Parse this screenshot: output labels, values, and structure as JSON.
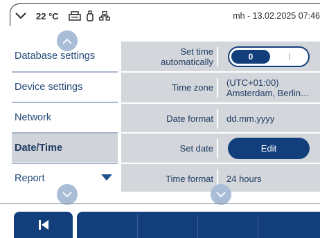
{
  "status_bar": {
    "temperature": "22 °C",
    "device_info": "mh - 13.02.2025 07:46",
    "icons": [
      "chevron-down-icon",
      "printer-icon",
      "usb-drive-icon",
      "network-icon"
    ]
  },
  "menu": {
    "items": [
      {
        "label": "Database settings"
      },
      {
        "label": "Device settings"
      },
      {
        "label": "Network"
      },
      {
        "label": "Date/Time",
        "active": true
      },
      {
        "label": "Report"
      }
    ]
  },
  "settings": {
    "set_time_auto": {
      "label_line1": "Set time",
      "label_line2": "automatically",
      "toggle_value": "0"
    },
    "time_zone": {
      "label": "Time zone",
      "value_line1": "(UTC+01:00)",
      "value_line2": "Amsterdam, Berlin…"
    },
    "date_format": {
      "label": "Date format",
      "value": "dd.mm.yyyy"
    },
    "set_date": {
      "label": "Set date",
      "button_label": "Edit"
    },
    "time_format": {
      "label": "Time format",
      "value": "24 hours"
    }
  },
  "colors": {
    "accent": "#123f7c",
    "panel_bg": "#d3d6da",
    "active_menu_bg": "#d0d3d8",
    "scroll_circle": "#a9bdd7",
    "menu_separator": "#a7b6cc"
  },
  "toolbar": {
    "back_icon": "skip-back-icon"
  }
}
